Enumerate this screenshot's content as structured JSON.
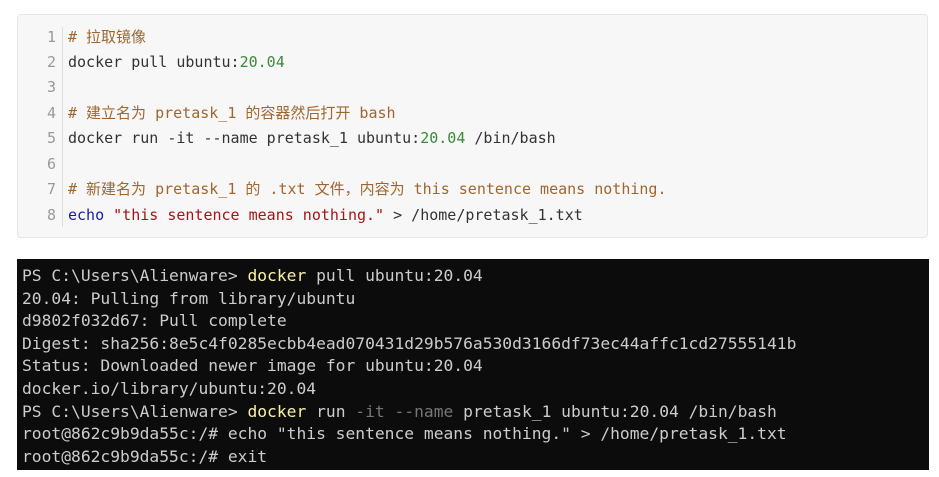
{
  "editor": {
    "lines": [
      {
        "n": "1",
        "comment": "# 拉取镜像"
      },
      {
        "n": "2",
        "cmd": "docker pull ubuntu:",
        "ver": "20.04"
      },
      {
        "n": "3"
      },
      {
        "n": "4",
        "comment": "# 建立名为 pretask_1 的容器然后打开 bash"
      },
      {
        "n": "5",
        "cmd": "docker run -it --name pretask_1 ubuntu:",
        "ver": "20.04",
        "tail": " /bin/bash"
      },
      {
        "n": "6"
      },
      {
        "n": "7",
        "comment": "# 新建名为 pretask_1 的 .txt 文件，内容为 this sentence means nothing."
      },
      {
        "n": "8",
        "kw": "echo",
        "str": " \"this sentence means nothing.\"",
        "tail": " > /home/pretask_1.txt"
      }
    ]
  },
  "terminal": {
    "l1": {
      "prompt": "PS C:\\Users\\Alienware> ",
      "cmd": "docker",
      "rest": " pull ubuntu:20.04"
    },
    "l2": "20.04: Pulling from library/ubuntu",
    "l3": "d9802f032d67: Pull complete",
    "l4": "Digest: sha256:8e5c4f0285ecbb4ead070431d29b576a530d3166df73ec44affc1cd27555141b",
    "l5": "Status: Downloaded newer image for ubuntu:20.04",
    "l6": "docker.io/library/ubuntu:20.04",
    "l7": {
      "prompt": "PS C:\\Users\\Alienware> ",
      "cmd": "docker",
      "run": " run ",
      "flag1": "-it",
      "flag2": " --name",
      "rest": " pretask_1 ubuntu:20.04 /bin/bash"
    },
    "l8": "root@862c9b9da55c:/# echo \"this sentence means nothing.\" > /home/pretask_1.txt",
    "l9": "root@862c9b9da55c:/# exit"
  }
}
